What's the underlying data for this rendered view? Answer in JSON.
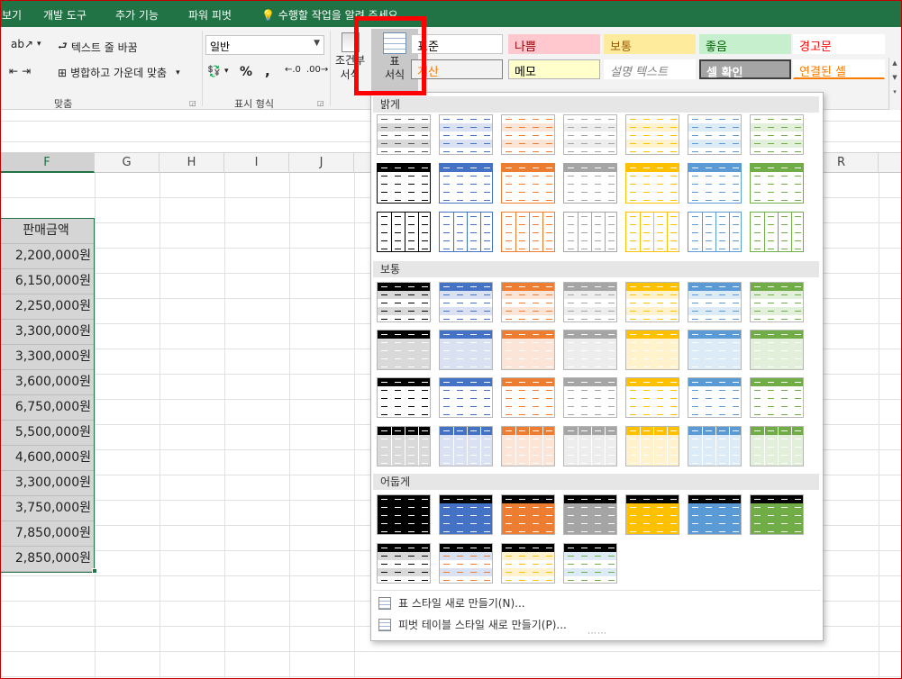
{
  "tabs": [
    "보기",
    "개발 도구",
    "추가 기능",
    "파워 피벗"
  ],
  "tell_me": "수행할 작업을 알려 주세요",
  "ribbon": {
    "wrap_text": "텍스트 줄 바꿈",
    "merge_center": "병합하고 가운데 맞춤",
    "align_group": "맞춤",
    "number_format_value": "일반",
    "percent": "%",
    "comma": ",",
    "number_group": "표시 형식",
    "conditional_line1": "조건부",
    "conditional_line2": "서식",
    "format_table_line1": "표",
    "format_table_line2": "서식"
  },
  "cell_styles": [
    {
      "label": "표준",
      "bg": "#ffffff",
      "color": "#000000"
    },
    {
      "label": "나쁨",
      "bg": "#ffc7ce",
      "color": "#9c0006"
    },
    {
      "label": "보통",
      "bg": "#ffeb9c",
      "color": "#9c5700"
    },
    {
      "label": "좋음",
      "bg": "#c6efce",
      "color": "#006100"
    },
    {
      "label": "경고문",
      "bg": "#ffffff",
      "color": "#ff0000"
    },
    {
      "label": "계산",
      "bg": "#f2f2f2",
      "color": "#fa7d00"
    },
    {
      "label": "메모",
      "bg": "#ffffcc",
      "color": "#000000"
    },
    {
      "label": "설명 텍스트",
      "bg": "#ffffff",
      "color": "#7f7f7f"
    },
    {
      "label": "셀 확인",
      "bg": "#a5a5a5",
      "color": "#ffffff"
    },
    {
      "label": "연결된 셀",
      "bg": "#ffffff",
      "color": "#fa7d00"
    }
  ],
  "columns": [
    "F",
    "G",
    "H",
    "I",
    "J",
    "R"
  ],
  "data_header": "판매금액",
  "data_values": [
    "2,200,000원",
    "6,150,000원",
    "2,250,000원",
    "3,300,000원",
    "3,300,000원",
    "3,600,000원",
    "6,750,000원",
    "5,500,000원",
    "4,600,000원",
    "3,300,000원",
    "3,750,000원",
    "7,850,000원",
    "2,850,000원"
  ],
  "gallery": {
    "sections": [
      "밝게",
      "보통",
      "어둡게"
    ],
    "theme_colors": [
      "#000000",
      "#4472c4",
      "#ed7d31",
      "#a5a5a5",
      "#ffc000",
      "#5b9bd5",
      "#70ad47"
    ],
    "light_colors": [
      "#d9d9d9",
      "#d9e1f2",
      "#fce4d6",
      "#ededed",
      "#fff2cc",
      "#ddebf7",
      "#e2efda"
    ],
    "menu_new_table": "표 스타일 새로 만들기(N)...",
    "menu_new_pivot": "피벗 테이블 스타일 새로 만들기(P)..."
  }
}
